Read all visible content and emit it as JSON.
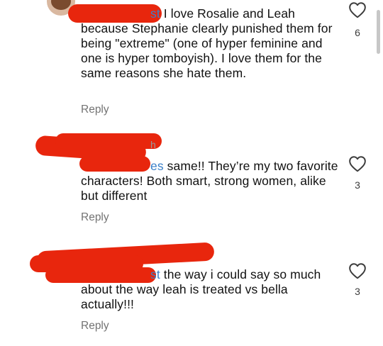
{
  "comments": [
    {
      "mention_tail": "st",
      "text": "I love Rosalie and Leah because Stephanie clearly punished them for being \"extreme\" (one of hyper feminine and one is hyper tomboyish). I love them for the same reasons she hate them.",
      "reply_label": "Reply",
      "likes": "6",
      "icon": "heart-outline-icon"
    },
    {
      "mention_tail": "es",
      "text": "same!! They’re my two favorite characters! Both smart, strong women, alike but different",
      "reply_label": "Reply",
      "likes": "3",
      "icon": "heart-outline-icon"
    },
    {
      "mention_tail": "st",
      "text": "the way i could say so much about the way leah is treated vs bella actually!!!",
      "reply_label": "Reply",
      "likes": "3",
      "icon": "heart-outline-icon"
    }
  ],
  "colors": {
    "redaction": "#e8260d",
    "mention": "#3b7fc7",
    "reply": "#737373"
  }
}
